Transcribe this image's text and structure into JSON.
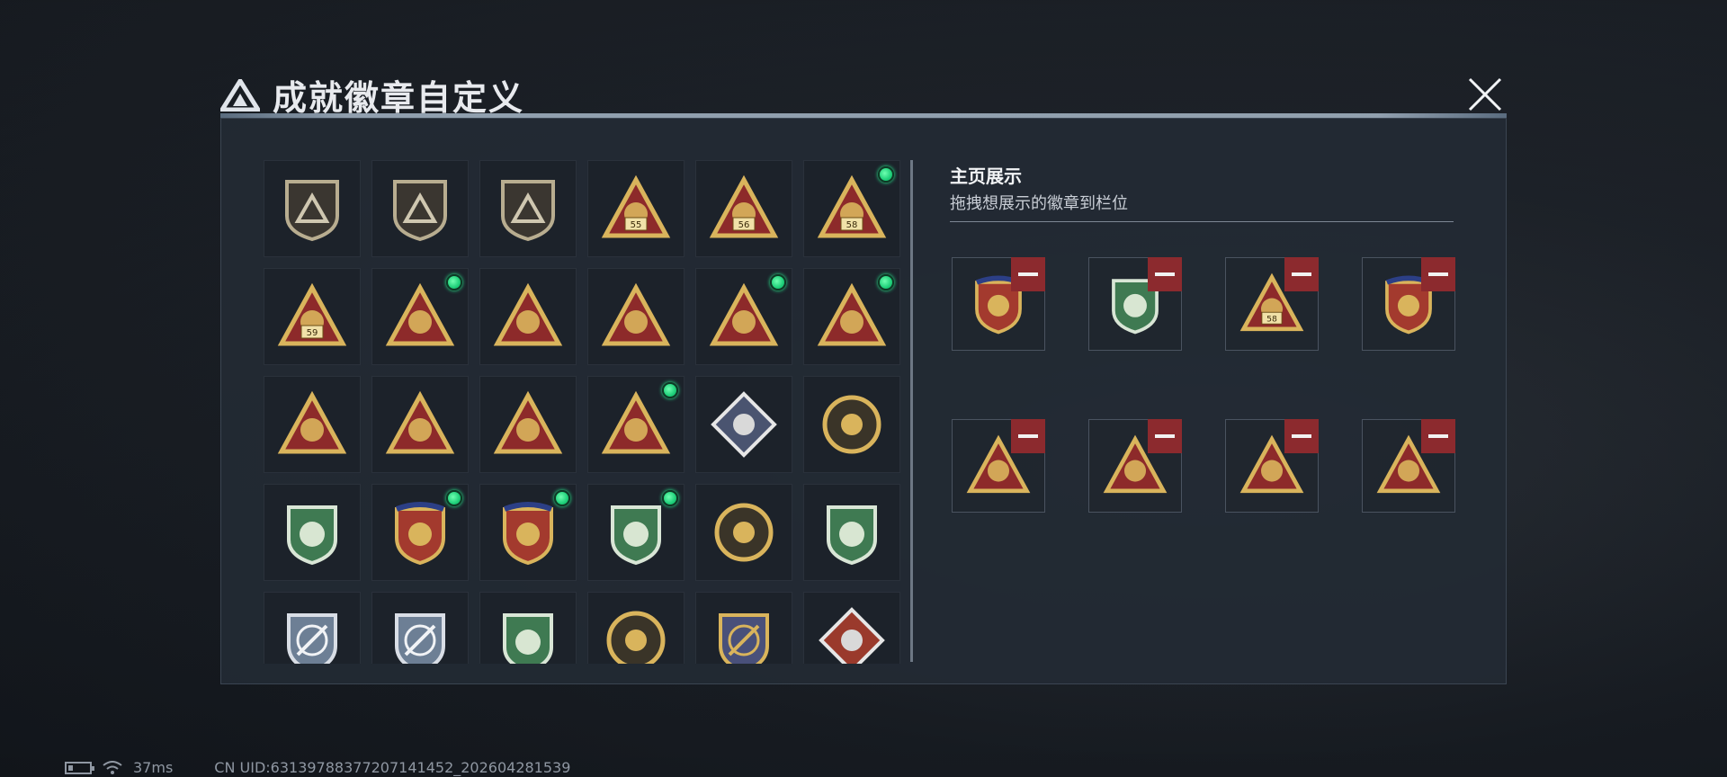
{
  "window": {
    "title": "成就徽章自定义",
    "close_label": "close"
  },
  "colors": {
    "gold": "#d9b45c",
    "red": "#8d2a2a",
    "green_badge": "#3f7a52",
    "steel": "#6d7f95",
    "remove": "#8c2a2e",
    "new_dot": "#1fd07a"
  },
  "showcase": {
    "title": "主页展示",
    "subtitle": "拖拽想展示的徽章到栏位"
  },
  "badges": [
    {
      "icon": "shield-triangle-icon",
      "new": false
    },
    {
      "icon": "shield-helicopter-icon",
      "new": false
    },
    {
      "icon": "shield-dagger-icon",
      "new": false
    },
    {
      "icon": "triangle-55-icon",
      "new": false
    },
    {
      "icon": "triangle-56-icon",
      "new": false
    },
    {
      "icon": "triangle-58-icon",
      "new": true
    },
    {
      "icon": "triangle-59-icon",
      "new": false
    },
    {
      "icon": "triangle-trophy-icon",
      "new": true
    },
    {
      "icon": "triangle-boat-icon",
      "new": false
    },
    {
      "icon": "triangle-number-one-icon",
      "new": false
    },
    {
      "icon": "triangle-usb-icon",
      "new": true
    },
    {
      "icon": "triangle-kneeling-figure-icon",
      "new": true
    },
    {
      "icon": "triangle-hands-icon",
      "new": false
    },
    {
      "icon": "triangle-soldiers-icon",
      "new": false
    },
    {
      "icon": "triangle-squad-icon",
      "new": false
    },
    {
      "icon": "triangle-rocket-icon",
      "new": true
    },
    {
      "icon": "diamond-rose-icon",
      "new": false
    },
    {
      "icon": "round-star-emblem-icon",
      "new": false
    },
    {
      "icon": "green-shield-icon",
      "new": false
    },
    {
      "icon": "red-shield-gold-icon",
      "new": true
    },
    {
      "icon": "red-shield-crystal-icon",
      "new": true
    },
    {
      "icon": "green-pearl-icon",
      "new": true
    },
    {
      "icon": "round-crosshair-face-icon",
      "new": false
    },
    {
      "icon": "green-flower-icon",
      "new": false
    },
    {
      "icon": "blue-crosshair-rifle-icon",
      "new": false
    },
    {
      "icon": "blue-crosshair-rifle-2-icon",
      "new": false
    },
    {
      "icon": "green-crosshair-rifle-icon",
      "new": false
    },
    {
      "icon": "round-scope-icon",
      "new": false
    },
    {
      "icon": "gold-crosshair-rifle-icon",
      "new": false
    },
    {
      "icon": "diamond-wolf-icon",
      "new": false
    }
  ],
  "slots": [
    {
      "icon": "red-shield-crystal-icon"
    },
    {
      "icon": "green-pearl-icon"
    },
    {
      "icon": "triangle-58-icon"
    },
    {
      "icon": "red-shield-gold-icon"
    },
    {
      "icon": "triangle-usb-icon"
    },
    {
      "icon": "triangle-rocket-icon"
    },
    {
      "icon": "triangle-trophy-icon"
    },
    {
      "icon": "triangle-kneeling-figure-icon"
    }
  ],
  "status": {
    "latency": "37ms",
    "uid": "CN UID:6313978837720714145​2_202604281539"
  }
}
